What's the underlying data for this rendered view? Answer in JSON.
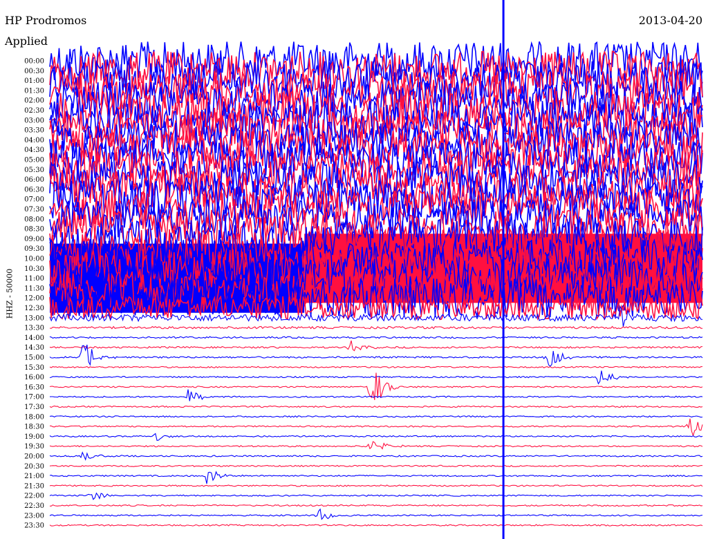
{
  "header": {
    "station": "HP Prodromos",
    "filter": "Applied",
    "date": "2013-04-20"
  },
  "chart_data": {
    "type": "line",
    "chart_kind": "helicorder",
    "title": "HP Prodromos",
    "subtitle": "Applied",
    "date": "2013-04-20",
    "ylabel": "HHZ - 50000",
    "row_minutes": 30,
    "row_labels": [
      "00:00",
      "00:30",
      "01:00",
      "01:30",
      "02:00",
      "02:30",
      "03:00",
      "03:30",
      "04:00",
      "04:30",
      "05:00",
      "05:30",
      "06:00",
      "06:30",
      "07:00",
      "07:30",
      "08:00",
      "08:30",
      "09:00",
      "09:30",
      "10:00",
      "10:30",
      "11:00",
      "11:30",
      "12:00",
      "12:30",
      "13:00",
      "13:30",
      "14:00",
      "14:30",
      "15:00",
      "15:30",
      "16:00",
      "16:30",
      "17:00",
      "17:30",
      "18:00",
      "18:30",
      "19:00",
      "19:30",
      "20:00",
      "20:30",
      "21:00",
      "21:30",
      "22:00",
      "22:30",
      "23:00",
      "23:30"
    ],
    "series_colors": [
      "#0000ff",
      "#ff1040"
    ],
    "saturated_blocks": [
      {
        "from": "09:30",
        "to": "12:30",
        "color_index": 0,
        "x_fraction_end": 0.39
      },
      {
        "from": "09:00",
        "to": "12:00",
        "color_index": 1,
        "x_fraction_start": 0.39
      }
    ],
    "noise_level_by_row": [
      1,
      1,
      1,
      1,
      1,
      1,
      1,
      1,
      1,
      1,
      1,
      1,
      1,
      1,
      1,
      1,
      1,
      1,
      1,
      1,
      1,
      1,
      1,
      1,
      1,
      0.6,
      0.25,
      0.08,
      0.06,
      0.06,
      0.06,
      0.05,
      0.05,
      0.05,
      0.05,
      0.05,
      0.05,
      0.05,
      0.05,
      0.05,
      0.05,
      0.05,
      0.05,
      0.05,
      0.05,
      0.05,
      0.05,
      0.05
    ],
    "events": [
      {
        "row": "13:00",
        "x": 0.87,
        "amp": 1.2
      },
      {
        "row": "14:30",
        "x": 0.46,
        "amp": 0.8
      },
      {
        "row": "15:00",
        "x": 0.05,
        "amp": 2.2
      },
      {
        "row": "15:00",
        "x": 0.76,
        "amp": 1.6
      },
      {
        "row": "16:00",
        "x": 0.84,
        "amp": 1.0
      },
      {
        "row": "16:30",
        "x": 0.49,
        "amp": 3.0
      },
      {
        "row": "17:00",
        "x": 0.21,
        "amp": 0.9
      },
      {
        "row": "18:30",
        "x": 0.98,
        "amp": 1.4
      },
      {
        "row": "19:00",
        "x": 0.16,
        "amp": 0.6
      },
      {
        "row": "19:30",
        "x": 0.49,
        "amp": 1.0
      },
      {
        "row": "20:00",
        "x": 0.05,
        "amp": 0.6
      },
      {
        "row": "21:00",
        "x": 0.24,
        "amp": 1.0
      },
      {
        "row": "22:00",
        "x": 0.06,
        "amp": 0.7
      },
      {
        "row": "23:00",
        "x": 0.41,
        "amp": 0.9
      }
    ],
    "grid": false
  }
}
